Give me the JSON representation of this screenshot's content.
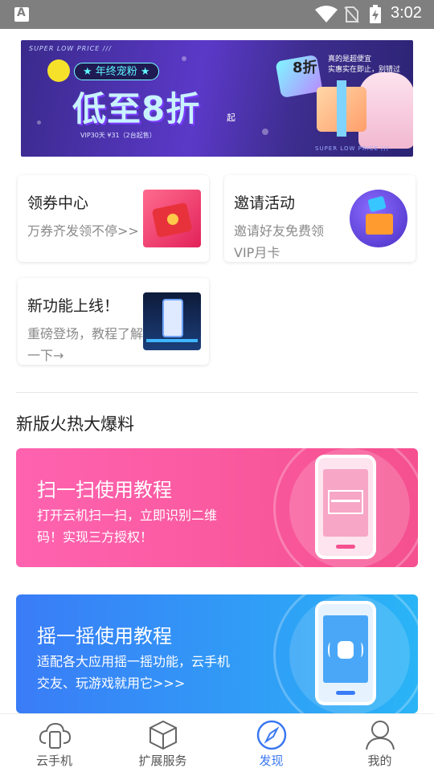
{
  "statusbar": {
    "time": "3:02",
    "left_icon": "A"
  },
  "banner": {
    "small_caption": "SUPER LOW PRICE ///",
    "pill": "★ 年终宠粉 ★",
    "headline": "低至8折",
    "headline_suffix": "起",
    "price_note": "VIP30天  ¥31（2台起售）",
    "badge": "8折",
    "tagline_1": "真的是超便宜",
    "tagline_2": "实惠实在即止，别错过",
    "footer_caption": "SUPER LOW PRICE ///"
  },
  "cards": [
    {
      "title": "领券中心",
      "desc": "万券齐发领不停>>"
    },
    {
      "title": "邀请活动",
      "desc": "邀请好友免费领VIP月卡"
    },
    {
      "title": "新功能上线！",
      "desc": "重磅登场，教程了解一下→"
    }
  ],
  "section_title": "新版火热大爆料",
  "promos": [
    {
      "title": "扫一扫使用教程",
      "desc": "打开云机扫一扫，立即识别二维码！实现三方授权！"
    },
    {
      "title": "摇一摇使用教程",
      "desc": "适配各大应用摇一摇功能，云手机交友、玩游戏就用它>>>"
    }
  ],
  "tabs": [
    {
      "label": "云手机",
      "icon": "cloud-phone-icon"
    },
    {
      "label": "扩展服务",
      "icon": "cube-icon"
    },
    {
      "label": "发现",
      "icon": "compass-icon"
    },
    {
      "label": "我的",
      "icon": "user-icon"
    }
  ],
  "colors": {
    "statusbar": "#7f7f7f",
    "accent": "#3a78f2",
    "promo_pink": "#f45c9d",
    "promo_blue": "#3b8bf8"
  }
}
